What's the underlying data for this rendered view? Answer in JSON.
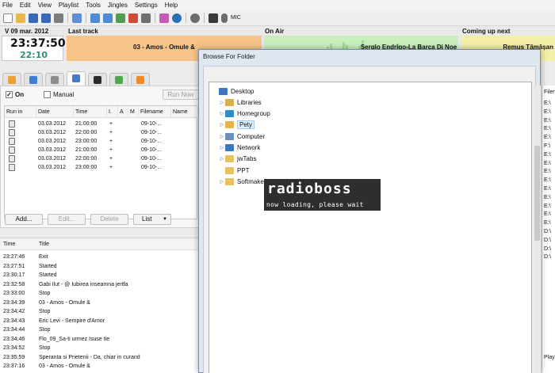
{
  "menu": [
    "File",
    "Edit",
    "View",
    "Playlist",
    "Tools",
    "Jingles",
    "Settings",
    "Help"
  ],
  "toolbar": {
    "icons": [
      "new-icon",
      "open-icon",
      "save-icon",
      "save-all-icon",
      "print-icon",
      "undo-icon",
      "move-up-icon",
      "move-down-icon",
      "insert-icon",
      "delete-icon",
      "shuffle-icon",
      "playlist-icon",
      "globe-icon",
      "settings-icon",
      "effects-icon",
      "mic-icon"
    ],
    "mic_label": "MIC"
  },
  "status": {
    "date": "V 09 mar. 2012",
    "clock": "23:37:50",
    "elapsed": "22:10",
    "last_track_title": "Last track",
    "last_track": "03 - Amos - Omule &",
    "on_air_title": "On Air",
    "on_air": "Sergio Endrigo-La Barca Di Noe",
    "coming_up_title": "Coming up next",
    "coming_up": "Remus Tămășan"
  },
  "tabs": [
    {
      "name": "tab-folder",
      "icon": "folder-icon",
      "color": "#e9a233"
    },
    {
      "name": "tab-search",
      "icon": "search-icon",
      "color": "#3f7fd0"
    },
    {
      "name": "tab-attach",
      "icon": "attach-icon",
      "color": "#8c8c8c"
    },
    {
      "name": "tab-clock",
      "icon": "clock-icon",
      "color": "#4a78c8"
    },
    {
      "name": "tab-terminal",
      "icon": "terminal-icon",
      "color": "#2b2b2b"
    },
    {
      "name": "tab-plugin",
      "icon": "plugin-icon",
      "color": "#4fa84a"
    },
    {
      "name": "tab-plus",
      "icon": "plus-icon",
      "color": "#f08a24"
    }
  ],
  "schedule": {
    "on_label": "On",
    "manual_label": "Manual",
    "run_now": "Run Now",
    "columns": [
      "Run in",
      "Date",
      "Time",
      "I.",
      "A",
      "M",
      "Filename",
      "Name"
    ],
    "rows": [
      {
        "date": "03.03.2012",
        "time": "21:00:00",
        "i": "+",
        "filename": "09-10-..."
      },
      {
        "date": "03.03.2012",
        "time": "22:00:00",
        "i": "+",
        "filename": "09-10-..."
      },
      {
        "date": "03.03.2012",
        "time": "23:00:00",
        "i": "+",
        "filename": "09-10-..."
      },
      {
        "date": "03.03.2012",
        "time": "21:00:00",
        "i": "+",
        "filename": "09-10-..."
      },
      {
        "date": "03.03.2012",
        "time": "22:00:00",
        "i": "+",
        "filename": "09-10-..."
      },
      {
        "date": "03.03.2012",
        "time": "23:00:00",
        "i": "+",
        "filename": "09-10-..."
      }
    ],
    "add_label": "Add...",
    "edit_label": "Edit...",
    "delete_label": "Delete",
    "list_label": "List"
  },
  "log": {
    "columns": [
      "Time",
      "Title"
    ],
    "rows": [
      {
        "time": "23:27:46",
        "title": "Exit"
      },
      {
        "time": "23:27:51",
        "title": "Started"
      },
      {
        "time": "23:30:17",
        "title": "Started"
      },
      {
        "time": "23:32:58",
        "title": "Gabi Ilut - @ Iubirea inseamna jertfa"
      },
      {
        "time": "23:33:00",
        "title": "Stop"
      },
      {
        "time": "23:34:39",
        "title": "03 - Amos - Omule &"
      },
      {
        "time": "23:34:42",
        "title": "Stop"
      },
      {
        "time": "23:34:43",
        "title": "Eric Levi - Sempire d'Amor"
      },
      {
        "time": "23:34:44",
        "title": "Stop"
      },
      {
        "time": "23:34:46",
        "title": "Flo_09_Sa-ti urmez Isuse tie"
      },
      {
        "time": "23:34:52",
        "title": "Stop"
      },
      {
        "time": "23:35:59",
        "title": "Speranta si Prietenii - Da, chiar in curand"
      },
      {
        "time": "23:37:16",
        "title": "03 - Amos - Omule &"
      }
    ]
  },
  "right_list": {
    "header": "Filen",
    "rows": [
      "E:\\",
      "E:\\",
      "E:\\",
      "E:\\",
      "E:\\",
      "F:\\",
      "E:\\",
      "E:\\",
      "E:\\",
      "E:\\",
      "E:\\",
      "E:\\",
      "E:\\",
      "E:\\",
      "E:\\",
      "D:\\",
      "D:\\",
      "D:\\",
      "D:\\"
    ],
    "footer": "Playi"
  },
  "dialog": {
    "title": "Browse For Folder",
    "tree": [
      {
        "label": "Desktop",
        "icon": "desktop-icon",
        "color": "#3d74c4",
        "arrow": ""
      },
      {
        "label": "Libraries",
        "icon": "libraries-icon",
        "color": "#d9b14a",
        "arrow": "▷"
      },
      {
        "label": "Homegroup",
        "icon": "homegroup-icon",
        "color": "#2f8ec9",
        "arrow": "▷"
      },
      {
        "label": "Pety",
        "icon": "user-folder-icon",
        "color": "#e6b34a",
        "arrow": "▷"
      },
      {
        "label": "Computer",
        "icon": "computer-icon",
        "color": "#6a8fb8",
        "arrow": "▷"
      },
      {
        "label": "Network",
        "icon": "network-icon",
        "color": "#3b79b9",
        "arrow": "▷"
      },
      {
        "label": "jwTabs",
        "icon": "folder-icon",
        "color": "#e7c15d",
        "arrow": "▷"
      },
      {
        "label": "PPT",
        "icon": "folder-icon",
        "color": "#e7c15d",
        "arrow": ""
      },
      {
        "label": "Softmaker 2",
        "icon": "folder-icon",
        "color": "#e7c15d",
        "arrow": "▷"
      }
    ]
  },
  "splash": {
    "logo": "radioboss",
    "subtitle": "now loading, please wait"
  },
  "colors": {
    "last_track": "#f7c389",
    "on_air": "#c9efbf",
    "coming_up": "#f4efa8",
    "elapsed": "#2f8f7a"
  }
}
